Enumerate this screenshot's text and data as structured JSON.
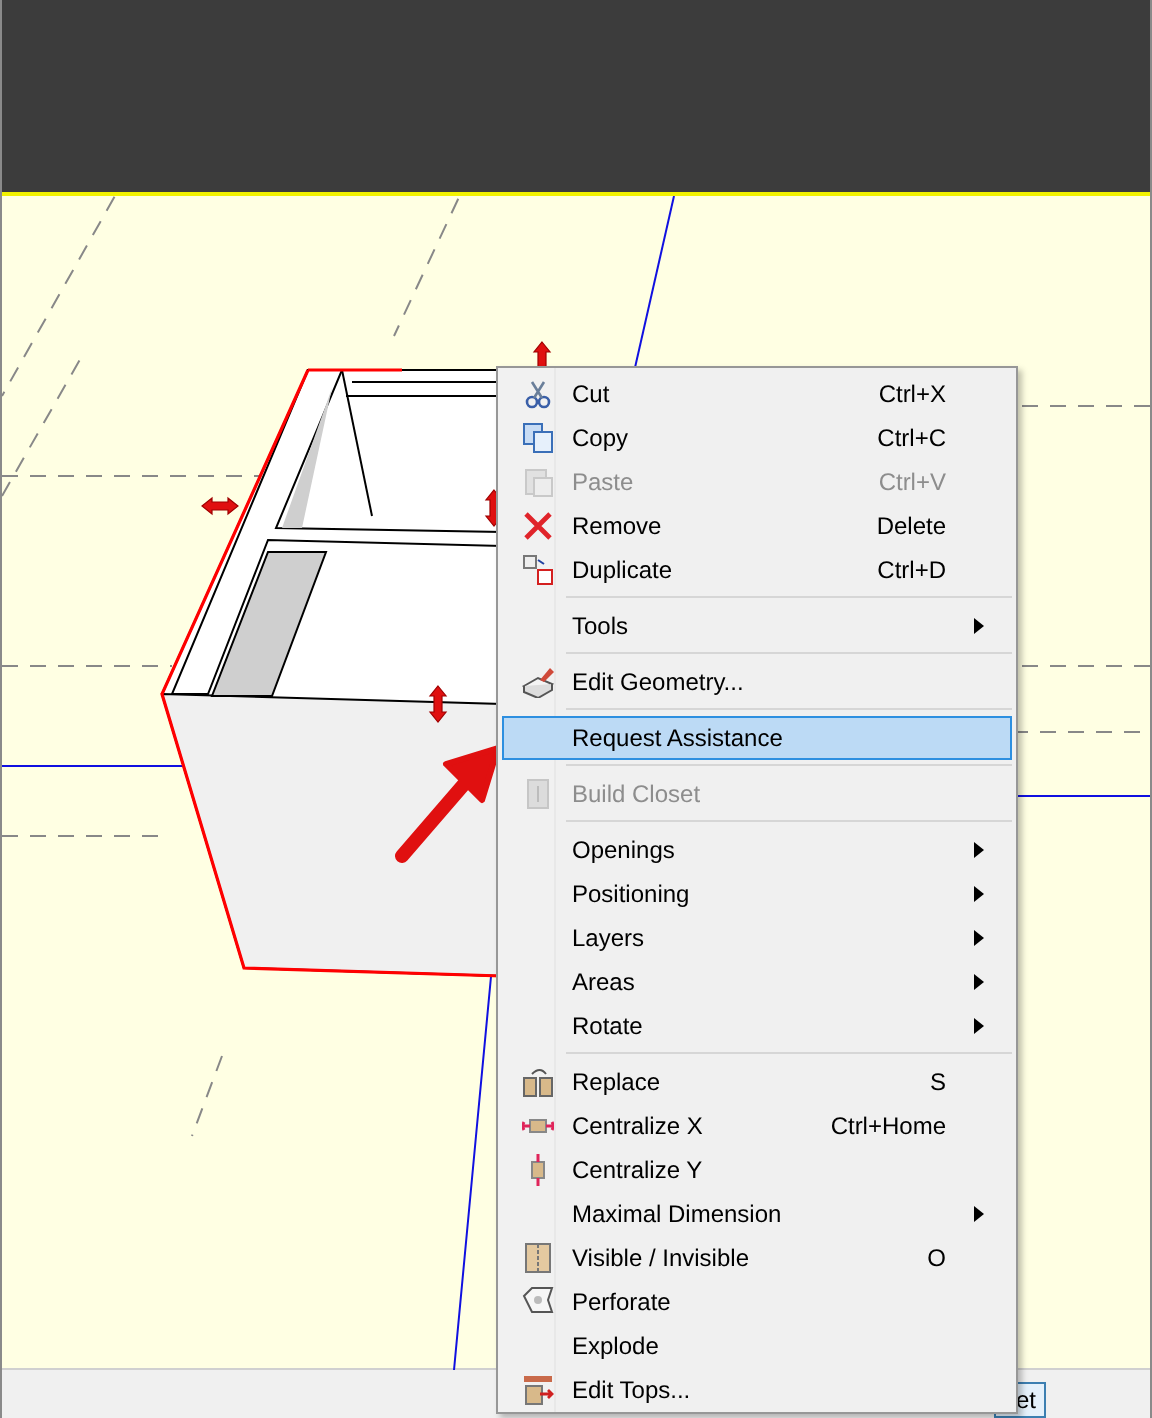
{
  "context_menu": {
    "items": [
      {
        "kind": "item",
        "label": "Cut",
        "shortcut": "Ctrl+X",
        "disabled": false,
        "submenu": false,
        "selected": false
      },
      {
        "kind": "item",
        "label": "Copy",
        "shortcut": "Ctrl+C",
        "disabled": false,
        "submenu": false,
        "selected": false
      },
      {
        "kind": "item",
        "label": "Paste",
        "shortcut": "Ctrl+V",
        "disabled": true,
        "submenu": false,
        "selected": false
      },
      {
        "kind": "item",
        "label": "Remove",
        "shortcut": "Delete",
        "disabled": false,
        "submenu": false,
        "selected": false
      },
      {
        "kind": "item",
        "label": "Duplicate",
        "shortcut": "Ctrl+D",
        "disabled": false,
        "submenu": false,
        "selected": false
      },
      {
        "kind": "separator"
      },
      {
        "kind": "item",
        "label": "Tools",
        "disabled": false,
        "submenu": true,
        "selected": false
      },
      {
        "kind": "separator"
      },
      {
        "kind": "item",
        "label": "Edit Geometry...",
        "disabled": false,
        "submenu": false,
        "selected": false
      },
      {
        "kind": "separator"
      },
      {
        "kind": "item",
        "label": "Request Assistance",
        "disabled": false,
        "submenu": false,
        "selected": true
      },
      {
        "kind": "separator"
      },
      {
        "kind": "item",
        "label": "Build Closet",
        "disabled": true,
        "submenu": false,
        "selected": false
      },
      {
        "kind": "separator"
      },
      {
        "kind": "item",
        "label": "Openings",
        "disabled": false,
        "submenu": true,
        "selected": false
      },
      {
        "kind": "item",
        "label": "Positioning",
        "disabled": false,
        "submenu": true,
        "selected": false
      },
      {
        "kind": "item",
        "label": "Layers",
        "disabled": false,
        "submenu": true,
        "selected": false
      },
      {
        "kind": "item",
        "label": "Areas",
        "disabled": false,
        "submenu": true,
        "selected": false
      },
      {
        "kind": "item",
        "label": "Rotate",
        "disabled": false,
        "submenu": true,
        "selected": false
      },
      {
        "kind": "separator"
      },
      {
        "kind": "item",
        "label": "Replace",
        "shortcut": "S",
        "disabled": false,
        "submenu": false,
        "selected": false
      },
      {
        "kind": "item",
        "label": "Centralize X",
        "shortcut": "Ctrl+Home",
        "disabled": false,
        "submenu": false,
        "selected": false
      },
      {
        "kind": "item",
        "label": "Centralize Y",
        "disabled": false,
        "submenu": false,
        "selected": false
      },
      {
        "kind": "item",
        "label": "Maximal Dimension",
        "disabled": false,
        "submenu": true,
        "selected": false
      },
      {
        "kind": "item",
        "label": "Visible / Invisible",
        "shortcut": "O",
        "disabled": false,
        "submenu": false,
        "selected": false
      },
      {
        "kind": "item",
        "label": "Perforate",
        "disabled": false,
        "submenu": false,
        "selected": false
      },
      {
        "kind": "item",
        "label": "Explode",
        "disabled": false,
        "submenu": false,
        "selected": false
      },
      {
        "kind": "item",
        "label": "Edit Tops...",
        "disabled": false,
        "submenu": false,
        "selected": false
      }
    ]
  },
  "status_bar": {
    "button": "et"
  }
}
